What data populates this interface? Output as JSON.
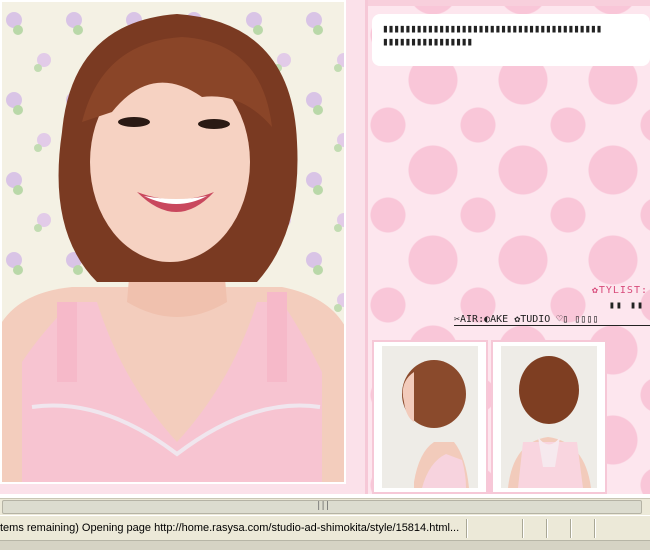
{
  "right_panel": {
    "message_lines": [
      "▮▮▮▮▮▮▮▮▮▮▮▮▮▮▮▮▮▮▮▮▮▮▮▮▮▮▮▮▮▮▮▮▮▮▮▮▮▮▮",
      "▮▮▮▮▮▮▮▮▮▮▮▮▮▮▮▮"
    ],
    "stylist_label": "✿TYLIST:",
    "stylist_value": "▮▮ ▮▮",
    "credit_line": "✂AIR:◐AKE ✿TUDIO ♡▯ ▯▯▯▯"
  },
  "scrollbar": {
    "grip": "|||"
  },
  "status_bar": {
    "text": "tems remaining) Opening page http://home.rasysa.com/studio-ad-shimokita/style/15814.html..."
  },
  "colors": {
    "pink_bg": "#fde6ee",
    "pink_dot": "#f9c6d8",
    "accent": "#d84a7a",
    "chrome": "#ece9d8"
  }
}
